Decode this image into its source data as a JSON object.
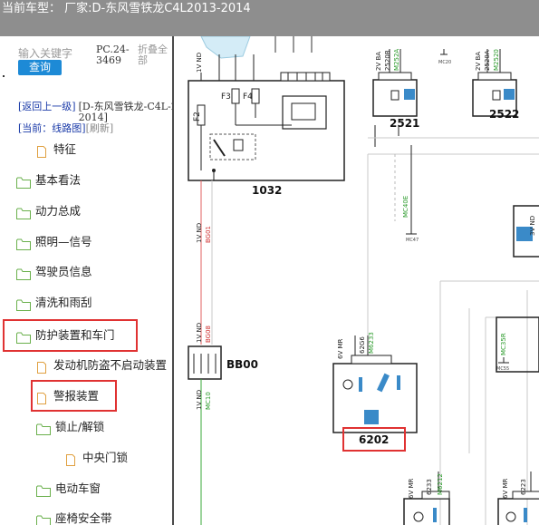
{
  "title": "当前车型： 厂家:D-东风雪铁龙C4L2013-2014",
  "search": {
    "placeholder": "输入关键字",
    "button_label": "查询"
  },
  "pc_code": "PC.24-3469",
  "collapse_all": "折叠全部",
  "nav": {
    "back": "[返回上一级]",
    "model": "[D-东风雪铁龙-C4L-2013-2014]",
    "current": "[当前：线路图]",
    "refresh": "[刷新]"
  },
  "tree": [
    {
      "label": "特征",
      "type": "file"
    },
    {
      "label": "基本看法",
      "type": "folder"
    },
    {
      "label": "动力总成",
      "type": "folder"
    },
    {
      "label": "照明—信号",
      "type": "folder"
    },
    {
      "label": "驾驶员信息",
      "type": "folder"
    },
    {
      "label": "清洗和雨刮",
      "type": "folder"
    },
    {
      "label": "防护装置和车门",
      "type": "folder",
      "highlighted": true
    },
    {
      "label": "发动机防盗不启动装置",
      "type": "file"
    },
    {
      "label": "警报装置",
      "type": "file",
      "highlighted": true
    },
    {
      "label": "锁止/解锁",
      "type": "folder"
    },
    {
      "label": "中央门锁",
      "type": "file"
    },
    {
      "label": "电动车窗",
      "type": "folder"
    },
    {
      "label": "座椅安全带",
      "type": "folder"
    }
  ],
  "diagram": {
    "components": {
      "c1032": "1032",
      "c2521": "2521",
      "c2522": "2522",
      "bb00": "BB00",
      "c6202": "6202"
    },
    "fuses": {
      "f2": "F2",
      "f3": "F3",
      "f4": "F4"
    },
    "wire_labels": {
      "w1vnd_a": "1V ND",
      "w1vnd_b": "1V ND",
      "w1vnd_c": "1V ND",
      "w1vnd_d": "1V ND",
      "bg01": "BG01",
      "bg08": "BG08",
      "mc10": "MC10",
      "w2vba_a": "2V BA",
      "w2vba_b": "2V BA",
      "s2520b": "2520B",
      "m252a": "M252A",
      "s2520a": "2520A",
      "m2520": "M2520",
      "mc20": "MC20",
      "mc40e": "MC40E",
      "mc47": "MC47",
      "w6vmr": "6V MR",
      "s62g6": "62G6",
      "m6233": "M6233",
      "mc35r": "MC35R",
      "mc55": "MC55",
      "w3vnd": "3V ND",
      "w6vmr_b": "6V MR",
      "w6vmr_c": "6V MR",
      "s6233": "6233",
      "m6212": "M6212",
      "s6223": "6223"
    }
  },
  "colors": {
    "accent": "#1d8ad6",
    "highlight": "#e03232",
    "title_bar": "#8e8e8e"
  }
}
